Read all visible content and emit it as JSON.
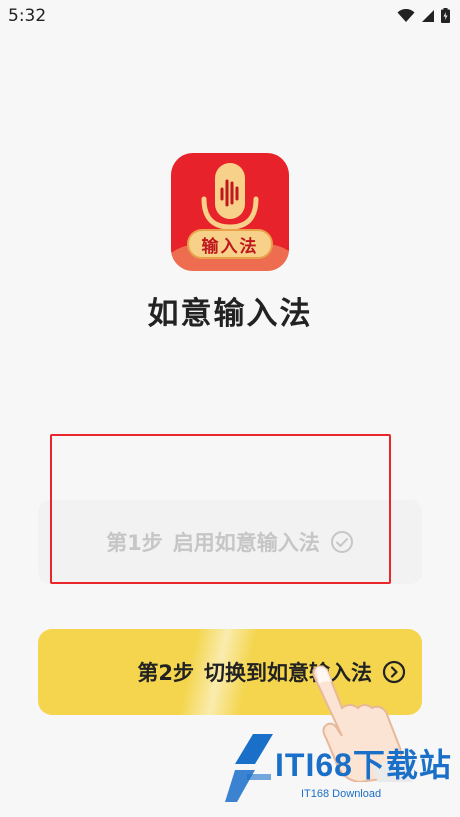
{
  "status_bar": {
    "time": "5:32",
    "icons": [
      "wifi-icon",
      "signal-icon",
      "battery-icon"
    ]
  },
  "app": {
    "logo_badge_text": "输入法",
    "name": "如意输入法"
  },
  "steps": {
    "step1": {
      "number_label": "第1步",
      "text": "启用如意输入法",
      "status_icon": "check-circle-icon",
      "state": "disabled"
    },
    "step2": {
      "number_label": "第2步",
      "text": "切换到如意输入法",
      "action_icon": "chevron-right-circle-icon"
    }
  },
  "watermark": {
    "brand": "ITI68下载站",
    "sub": "IT168 Download"
  },
  "colors": {
    "accent_yellow": "#f4d54d",
    "logo_red": "#e8222a",
    "highlight_outline": "#e8262b",
    "watermark_blue": "#1a6fc9"
  }
}
